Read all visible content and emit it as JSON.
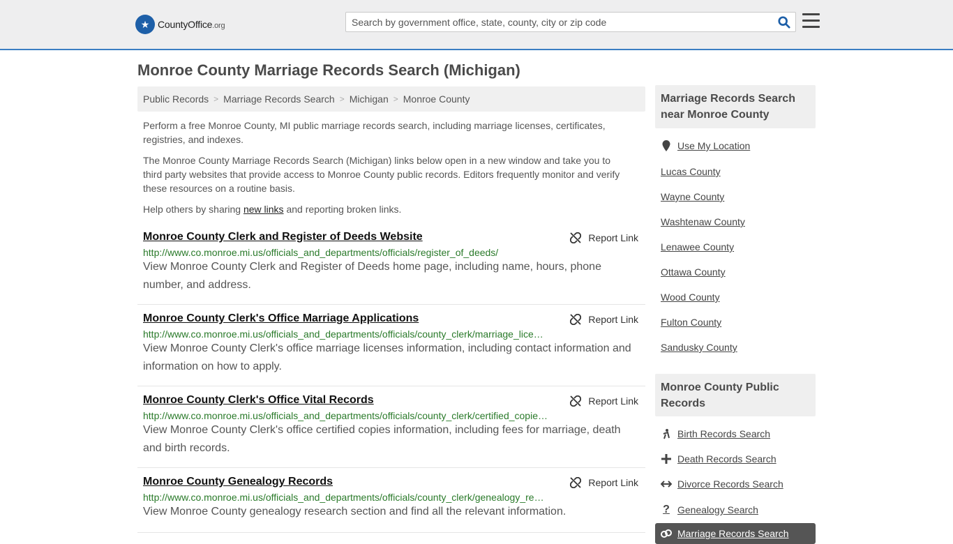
{
  "header": {
    "logo_main": "CountyOffice",
    "logo_suffix": ".org",
    "search_placeholder": "Search by government office, state, county, city or zip code"
  },
  "page": {
    "title": "Monroe County Marriage Records Search (Michigan)",
    "breadcrumb": [
      "Public Records",
      "Marriage Records Search",
      "Michigan",
      "Monroe County"
    ],
    "intro1": "Perform a free Monroe County, MI public marriage records search, including marriage licenses, certificates, registries, and indexes.",
    "intro2": "The Monroe County Marriage Records Search (Michigan) links below open in a new window and take you to third party websites that provide access to Monroe County public records. Editors frequently monitor and verify these resources on a routine basis.",
    "intro3_before": "Help others by sharing ",
    "intro3_link": "new links",
    "intro3_after": " and reporting broken links."
  },
  "results": [
    {
      "title": "Monroe County Clerk and Register of Deeds Website",
      "url": "http://www.co.monroe.mi.us/officials_and_departments/officials/register_of_deeds/",
      "desc": "View Monroe County Clerk and Register of Deeds home page, including name, hours, phone number, and address.",
      "report": "Report Link"
    },
    {
      "title": "Monroe County Clerk's Office Marriage Applications",
      "url": "http://www.co.monroe.mi.us/officials_and_departments/officials/county_clerk/marriage_licenses.html",
      "desc": "View Monroe County Clerk's office marriage licenses information, including contact information and information on how to apply.",
      "report": "Report Link"
    },
    {
      "title": "Monroe County Clerk's Office Vital Records",
      "url": "http://www.co.monroe.mi.us/officials_and_departments/officials/county_clerk/certified_copies.html",
      "desc": "View Monroe County Clerk's office certified copies information, including fees for marriage, death and birth records.",
      "report": "Report Link"
    },
    {
      "title": "Monroe County Genealogy Records",
      "url": "http://www.co.monroe.mi.us/officials_and_departments/officials/county_clerk/genealogy_records.html",
      "desc": "View Monroe County genealogy research section and find all the relevant information.",
      "report": "Report Link"
    }
  ],
  "sidebar": {
    "near_title": "Marriage Records Search near Monroe County",
    "use_location": "Use My Location",
    "near_counties": [
      "Lucas County",
      "Wayne County",
      "Washtenaw County",
      "Lenawee County",
      "Ottawa County",
      "Wood County",
      "Fulton County",
      "Sandusky County"
    ],
    "public_title": "Monroe County Public Records",
    "public_links": [
      {
        "label": "Birth Records Search",
        "icon": "birth-icon"
      },
      {
        "label": "Death Records Search",
        "icon": "plus-icon"
      },
      {
        "label": "Divorce Records Search",
        "icon": "arrows-icon"
      },
      {
        "label": "Genealogy Search",
        "icon": "question-icon"
      }
    ],
    "active_link": "Marriage Records Search"
  }
}
